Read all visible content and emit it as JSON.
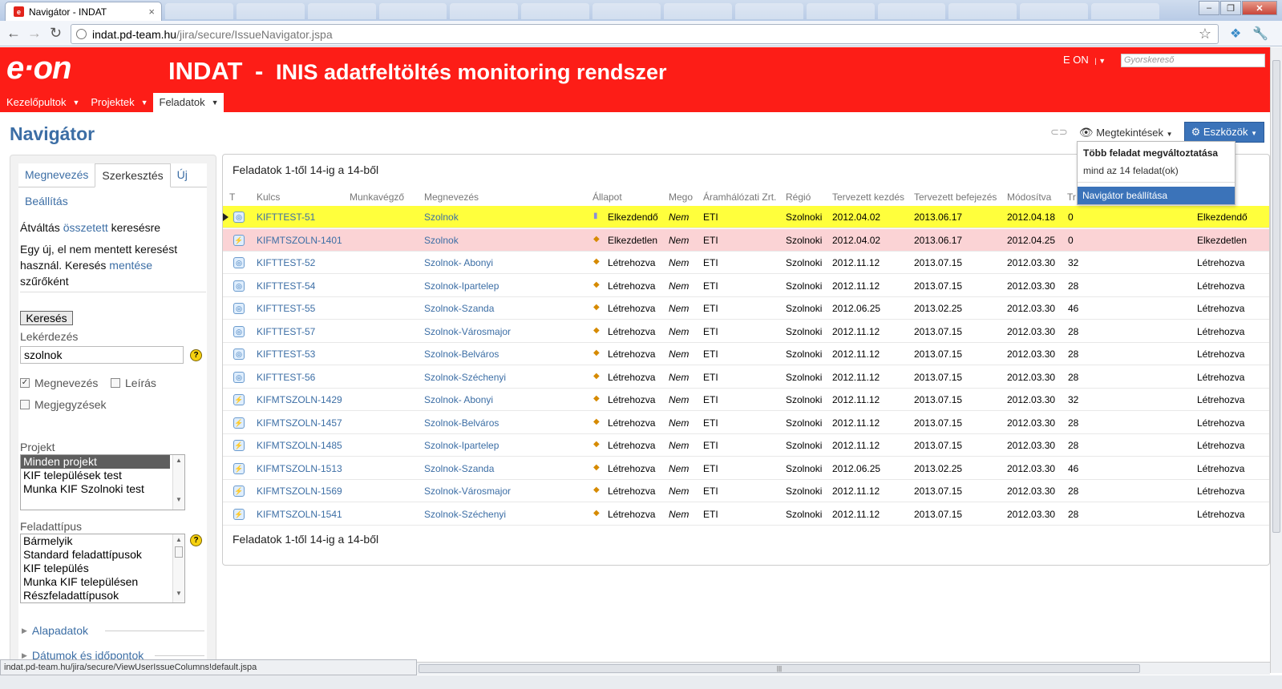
{
  "browser": {
    "tab_title": "Navigátor - INDAT",
    "tab_fav": "e",
    "tab_close": "×",
    "url_host": "indat.pd-team.hu",
    "url_path": "/jira/secure/IssueNavigator.jspa",
    "status_url": "indat.pd-team.hu/jira/secure/ViewUserIssueColumns!default.jspa",
    "win_minimize": "–",
    "win_maximize": "❐",
    "win_close": "✕"
  },
  "header": {
    "logo": "e·on",
    "app_name": "INDAT",
    "separator": "-",
    "subtitle": "INIS adatfeltöltés monitoring rendszer",
    "user": "E ON",
    "quick_search_placeholder": "Gyorskereső",
    "nav": [
      {
        "label": "Kezelőpultok"
      },
      {
        "label": "Projektek"
      },
      {
        "label": "Feladatok"
      }
    ]
  },
  "page": {
    "title": "Navigátor",
    "views_label": "Megtekintések",
    "tools_label": "Eszközök"
  },
  "dropdown": {
    "heading": "Több feladat megváltoztatása",
    "description": "mind az 14 feladat(ok)",
    "highlighted": "Navigátor beállítása"
  },
  "sidebar": {
    "tabs": [
      "Megnevezés",
      "Szerkesztés",
      "Új"
    ],
    "settings_link": "Beállítás",
    "switch_prefix": "Átváltás ",
    "switch_link": "összetett",
    "switch_suffix": " keresésre",
    "unsaved_line1": "Egy új, el nem mentett keresést",
    "unsaved_line2a": "használ. Keresés ",
    "unsaved_link": "mentése",
    "unsaved_line3": "szűrőként",
    "search_button": "Keresés",
    "query_label": "Lekérdezés",
    "query_value": "szolnok",
    "check_name": "Megnevezés",
    "check_desc": "Leírás",
    "check_comments": "Megjegyzések",
    "project_label": "Projekt",
    "projects": [
      "Minden projekt",
      "KIF települések test",
      "Munka KIF Szolnoki test"
    ],
    "type_label": "Feladattípus",
    "types": [
      "Bármelyik",
      "Standard feladattípusok",
      "KIF település",
      "Munka KIF településen",
      "Részfeladattípusok"
    ],
    "section_basic": "Alapadatok",
    "section_dates": "Dátumok és időpontok"
  },
  "results": {
    "count_text": "Feladatok 1-től 14-ig a 14-ből",
    "columns": [
      "T",
      "Kulcs",
      "Munkavégző",
      "Megnevezés",
      "Állapot",
      "Mego",
      "Áramhálózati Zrt.",
      "Régió",
      "Tervezett kezdés",
      "Tervezett befejezés",
      "Módosítva",
      "Tr"
    ],
    "rows": [
      {
        "key": "KIFTTEST-51",
        "name": "Szolnok",
        "status": "Elkezdendő",
        "mego": "Nem",
        "zrt": "ETI",
        "region": "Szolnoki",
        "start": "2012.04.02",
        "end": "2013.06.17",
        "mod": "2012.04.18",
        "tr": "0",
        "status2": "Elkezdendő",
        "type": "main"
      },
      {
        "key": "KIFMTSZOLN-1401",
        "name": "Szolnok",
        "status": "Elkezdetlen",
        "mego": "Nem",
        "zrt": "ETI",
        "region": "Szolnoki",
        "start": "2012.04.02",
        "end": "2013.06.17",
        "mod": "2012.04.25",
        "tr": "0",
        "status2": "Elkezdetlen",
        "type": "sub"
      },
      {
        "key": "KIFTTEST-52",
        "name": "Szolnok- Abonyi",
        "status": "Létrehozva",
        "mego": "Nem",
        "zrt": "ETI",
        "region": "Szolnoki",
        "start": "2012.11.12",
        "end": "2013.07.15",
        "mod": "2012.03.30",
        "tr": "32",
        "status2": "Létrehozva",
        "type": "main"
      },
      {
        "key": "KIFTTEST-54",
        "name": "Szolnok-Ipartelep",
        "status": "Létrehozva",
        "mego": "Nem",
        "zrt": "ETI",
        "region": "Szolnoki",
        "start": "2012.11.12",
        "end": "2013.07.15",
        "mod": "2012.03.30",
        "tr": "28",
        "status2": "Létrehozva",
        "type": "main"
      },
      {
        "key": "KIFTTEST-55",
        "name": "Szolnok-Szanda",
        "status": "Létrehozva",
        "mego": "Nem",
        "zrt": "ETI",
        "region": "Szolnoki",
        "start": "2012.06.25",
        "end": "2013.02.25",
        "mod": "2012.03.30",
        "tr": "46",
        "status2": "Létrehozva",
        "type": "main"
      },
      {
        "key": "KIFTTEST-57",
        "name": "Szolnok-Városmajor",
        "status": "Létrehozva",
        "mego": "Nem",
        "zrt": "ETI",
        "region": "Szolnoki",
        "start": "2012.11.12",
        "end": "2013.07.15",
        "mod": "2012.03.30",
        "tr": "28",
        "status2": "Létrehozva",
        "type": "main"
      },
      {
        "key": "KIFTTEST-53",
        "name": "Szolnok-Belváros",
        "status": "Létrehozva",
        "mego": "Nem",
        "zrt": "ETI",
        "region": "Szolnoki",
        "start": "2012.11.12",
        "end": "2013.07.15",
        "mod": "2012.03.30",
        "tr": "28",
        "status2": "Létrehozva",
        "type": "main"
      },
      {
        "key": "KIFTTEST-56",
        "name": "Szolnok-Széchenyi",
        "status": "Létrehozva",
        "mego": "Nem",
        "zrt": "ETI",
        "region": "Szolnoki",
        "start": "2012.11.12",
        "end": "2013.07.15",
        "mod": "2012.03.30",
        "tr": "28",
        "status2": "Létrehozva",
        "type": "main"
      },
      {
        "key": "KIFMTSZOLN-1429",
        "name": "Szolnok- Abonyi",
        "status": "Létrehozva",
        "mego": "Nem",
        "zrt": "ETI",
        "region": "Szolnoki",
        "start": "2012.11.12",
        "end": "2013.07.15",
        "mod": "2012.03.30",
        "tr": "32",
        "status2": "Létrehozva",
        "type": "sub"
      },
      {
        "key": "KIFMTSZOLN-1457",
        "name": "Szolnok-Belváros",
        "status": "Létrehozva",
        "mego": "Nem",
        "zrt": "ETI",
        "region": "Szolnoki",
        "start": "2012.11.12",
        "end": "2013.07.15",
        "mod": "2012.03.30",
        "tr": "28",
        "status2": "Létrehozva",
        "type": "sub"
      },
      {
        "key": "KIFMTSZOLN-1485",
        "name": "Szolnok-Ipartelep",
        "status": "Létrehozva",
        "mego": "Nem",
        "zrt": "ETI",
        "region": "Szolnoki",
        "start": "2012.11.12",
        "end": "2013.07.15",
        "mod": "2012.03.30",
        "tr": "28",
        "status2": "Létrehozva",
        "type": "sub"
      },
      {
        "key": "KIFMTSZOLN-1513",
        "name": "Szolnok-Szanda",
        "status": "Létrehozva",
        "mego": "Nem",
        "zrt": "ETI",
        "region": "Szolnoki",
        "start": "2012.06.25",
        "end": "2013.02.25",
        "mod": "2012.03.30",
        "tr": "46",
        "status2": "Létrehozva",
        "type": "sub"
      },
      {
        "key": "KIFMTSZOLN-1569",
        "name": "Szolnok-Városmajor",
        "status": "Létrehozva",
        "mego": "Nem",
        "zrt": "ETI",
        "region": "Szolnoki",
        "start": "2012.11.12",
        "end": "2013.07.15",
        "mod": "2012.03.30",
        "tr": "28",
        "status2": "Létrehozva",
        "type": "sub"
      },
      {
        "key": "KIFMTSZOLN-1541",
        "name": "Szolnok-Széchenyi",
        "status": "Létrehozva",
        "mego": "Nem",
        "zrt": "ETI",
        "region": "Szolnoki",
        "start": "2012.11.12",
        "end": "2013.07.15",
        "mod": "2012.03.30",
        "tr": "28",
        "status2": "Létrehozva",
        "type": "sub"
      }
    ]
  },
  "colors": {
    "brand_red": "#fd1d17",
    "link_blue": "#3c6ea5",
    "current_row": "#ffff3c",
    "error_row": "#fbd3d5"
  }
}
